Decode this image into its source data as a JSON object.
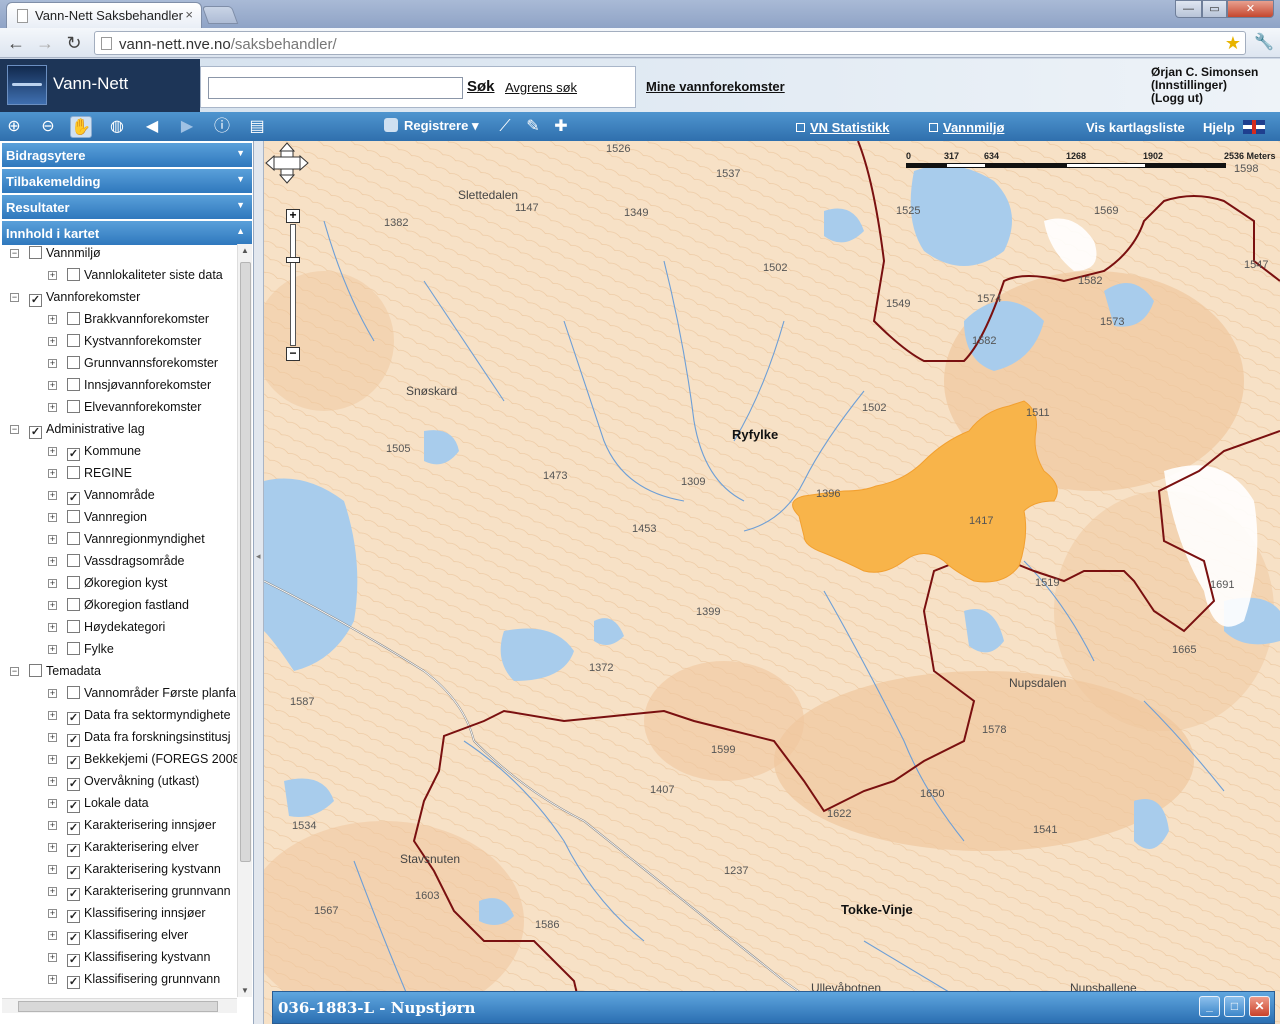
{
  "browser": {
    "tab_title": "Vann-Nett Saksbehandler",
    "tab_close": "×",
    "url_host": "vann-nett.nve.no",
    "url_path": "/saksbehandler/"
  },
  "header": {
    "app_title": "Vann-Nett",
    "search_value": "",
    "search_button": "Søk",
    "refine_link": "Avgrens søk",
    "my_waters": "Mine vannforekomster",
    "user_name": "Ørjan C. Simonsen",
    "user_settings": "(Innstillinger)",
    "user_logout": "(Logg ut)"
  },
  "map_toolbar": {
    "registrere": "Registrere",
    "vn_statistikk": "VN Statistikk",
    "vannmiljo": "Vannmiljø",
    "vis_kartlagsliste": "Vis kartlagsliste",
    "hjelp": "Hjelp",
    "icons": [
      "zoom-in-icon",
      "zoom-out-icon",
      "pan-hand-icon",
      "globe-icon",
      "arrow-left-icon",
      "arrow-right-icon",
      "info-icon",
      "print-icon"
    ]
  },
  "accordion": [
    {
      "label": "Bidragsytere",
      "expanded": false
    },
    {
      "label": "Tilbakemelding",
      "expanded": false
    },
    {
      "label": "Resultater",
      "expanded": false
    },
    {
      "label": "Innhold i kartet",
      "expanded": true
    }
  ],
  "tree": [
    {
      "level": 0,
      "label": "Vannmiljø",
      "checked": false,
      "toggle": "−"
    },
    {
      "level": 1,
      "label": "Vannlokaliteter siste data",
      "checked": false,
      "toggle": "+"
    },
    {
      "level": 0,
      "label": "Vannforekomster",
      "checked": true,
      "toggle": "−"
    },
    {
      "level": 1,
      "label": "Brakkvannforekomster",
      "checked": false,
      "toggle": "+"
    },
    {
      "level": 1,
      "label": "Kystvannforekomster",
      "checked": false,
      "toggle": "+"
    },
    {
      "level": 1,
      "label": "Grunnvannsforekomster",
      "checked": false,
      "toggle": "+"
    },
    {
      "level": 1,
      "label": "Innsjøvannforekomster",
      "checked": false,
      "toggle": "+"
    },
    {
      "level": 1,
      "label": "Elvevannforekomster",
      "checked": false,
      "toggle": "+"
    },
    {
      "level": 0,
      "label": "Administrative lag",
      "checked": true,
      "toggle": "−"
    },
    {
      "level": 1,
      "label": "Kommune",
      "checked": true,
      "toggle": "+"
    },
    {
      "level": 1,
      "label": "REGINE",
      "checked": false,
      "toggle": "+"
    },
    {
      "level": 1,
      "label": "Vannområde",
      "checked": true,
      "toggle": "+"
    },
    {
      "level": 1,
      "label": "Vannregion",
      "checked": false,
      "toggle": "+"
    },
    {
      "level": 1,
      "label": "Vannregionmyndighet",
      "checked": false,
      "toggle": "+"
    },
    {
      "level": 1,
      "label": "Vassdragsområde",
      "checked": false,
      "toggle": "+"
    },
    {
      "level": 1,
      "label": "Økoregion kyst",
      "checked": false,
      "toggle": "+"
    },
    {
      "level": 1,
      "label": "Økoregion fastland",
      "checked": false,
      "toggle": "+"
    },
    {
      "level": 1,
      "label": "Høydekategori",
      "checked": false,
      "toggle": "+"
    },
    {
      "level": 1,
      "label": "Fylke",
      "checked": false,
      "toggle": "+"
    },
    {
      "level": 0,
      "label": "Temadata",
      "checked": false,
      "toggle": "−"
    },
    {
      "level": 1,
      "label": "Vannområder Første planfa",
      "checked": false,
      "toggle": "+"
    },
    {
      "level": 1,
      "label": "Data fra sektormyndighete",
      "checked": true,
      "toggle": "+"
    },
    {
      "level": 1,
      "label": "Data fra forskningsinstitusj",
      "checked": true,
      "toggle": "+"
    },
    {
      "level": 1,
      "label": "Bekkekjemi (FOREGS 2008",
      "checked": true,
      "toggle": "+"
    },
    {
      "level": 1,
      "label": "Overvåkning (utkast)",
      "checked": true,
      "toggle": "+"
    },
    {
      "level": 1,
      "label": "Lokale data",
      "checked": true,
      "toggle": "+"
    },
    {
      "level": 1,
      "label": "Karakterisering innsjøer",
      "checked": true,
      "toggle": "+"
    },
    {
      "level": 1,
      "label": "Karakterisering elver",
      "checked": true,
      "toggle": "+"
    },
    {
      "level": 1,
      "label": "Karakterisering kystvann",
      "checked": true,
      "toggle": "+"
    },
    {
      "level": 1,
      "label": "Karakterisering grunnvann",
      "checked": true,
      "toggle": "+"
    },
    {
      "level": 1,
      "label": "Klassifisering innsjøer",
      "checked": true,
      "toggle": "+"
    },
    {
      "level": 1,
      "label": "Klassifisering elver",
      "checked": true,
      "toggle": "+"
    },
    {
      "level": 1,
      "label": "Klassifisering kystvann",
      "checked": true,
      "toggle": "+"
    },
    {
      "level": 1,
      "label": "Klassifisering grunnvann",
      "checked": true,
      "toggle": "+"
    }
  ],
  "map": {
    "scale": {
      "labels": [
        "0",
        "317",
        "634",
        "1268",
        "1902",
        "2536 Meters"
      ]
    },
    "regions": {
      "ryfylke": "Ryfylke",
      "tokke": "Tokke-Vinje"
    },
    "places": {
      "slettedalen": "Slettedalen",
      "snoskard": "Snøskard",
      "nupsdalen": "Nupsdalen",
      "stavsnuten": "Stavsnuten",
      "ullevabotnen": "Ullevåbotnen",
      "nupsballene": "Nupsballene"
    },
    "heights": {
      "h1526": "1526",
      "h1537": "1537",
      "h1147": "1147",
      "h1349": "1349",
      "h1382": "1382",
      "h1525": "1525",
      "h1569": "1569",
      "h1598": "1598",
      "h1502a": "1502",
      "h1549": "1549",
      "h1574": "1574",
      "h1582": "1582",
      "h1573": "1573",
      "h1547": "1547",
      "h1582b": "1582",
      "h1502b": "1502",
      "h1511": "1511",
      "h1505": "1505",
      "h1473": "1473",
      "h1309": "1309",
      "h1396": "1396",
      "h1417": "1417",
      "h1453": "1453",
      "h1519": "1519",
      "h1691": "1691",
      "h1399": "1399",
      "h1372": "1372",
      "h1665": "1665",
      "h1587": "1587",
      "h1578": "1578",
      "h1599": "1599",
      "h1407": "1407",
      "h1650": "1650",
      "h1534": "1534",
      "h1622": "1622",
      "h1541": "1541",
      "h1237": "1237",
      "h1603": "1603",
      "h1567": "1567",
      "h1586": "1586"
    }
  },
  "info_window": {
    "title": "036-1883-L - Nupstjørn",
    "min": "_",
    "max": "□",
    "close": "✕"
  }
}
